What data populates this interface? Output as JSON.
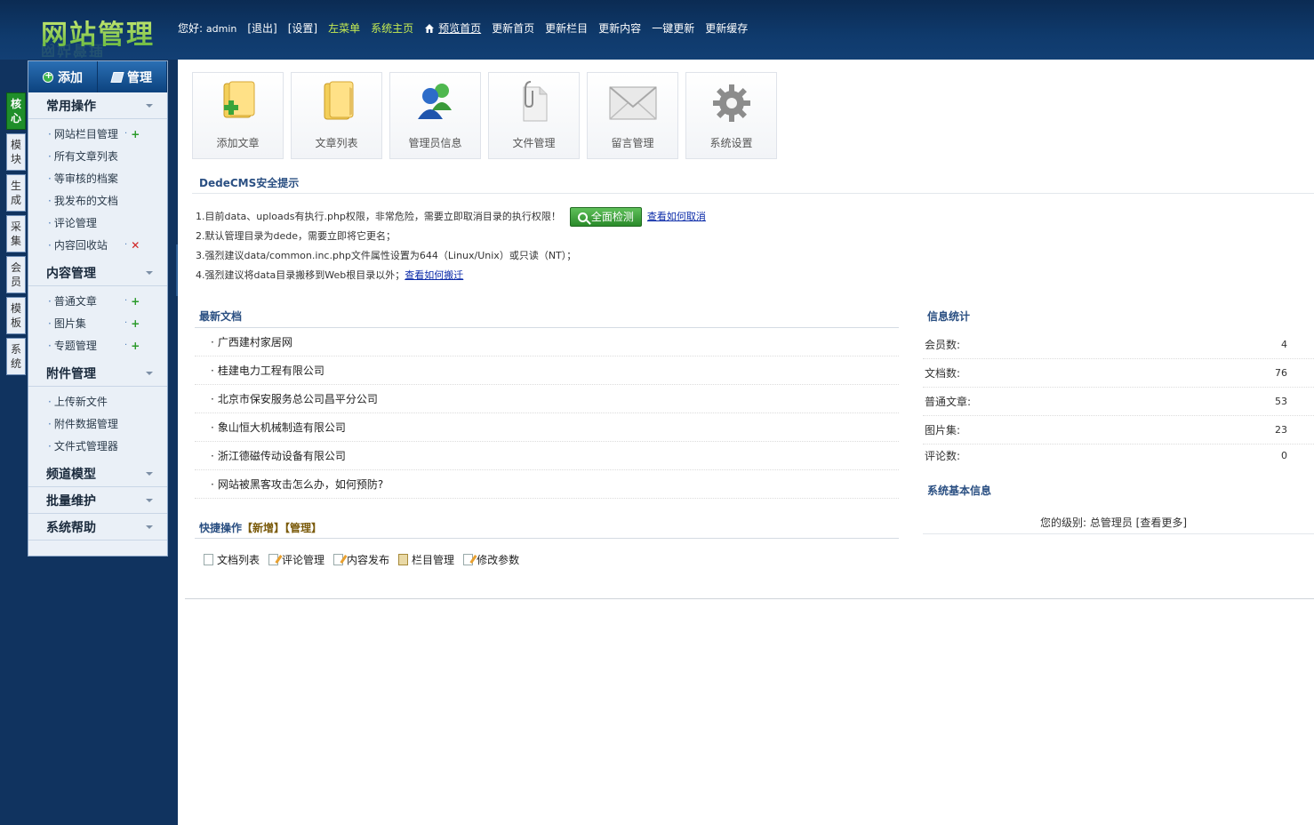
{
  "header": {
    "logo": "网站管理",
    "greeting": "您好:",
    "user": "admin",
    "logout": "[退出]",
    "settings": "[设置]",
    "left_menu": "左菜单",
    "system_home": "系统主页",
    "preview_home": "预览首页",
    "update_home": "更新首页",
    "update_columns": "更新栏目",
    "update_content": "更新内容",
    "one_click_update": "一键更新",
    "update_cache": "更新缓存"
  },
  "vertical_tabs": [
    "核心",
    "模块",
    "生成",
    "采集",
    "会员",
    "模板",
    "系统"
  ],
  "sidebar": {
    "add_label": "添加",
    "manage_label": "管理",
    "groups": [
      {
        "title": "常用操作",
        "items": [
          {
            "label": "网站栏目管理",
            "action": "add"
          },
          {
            "label": "所有文章列表",
            "action": ""
          },
          {
            "label": "等审核的档案",
            "action": ""
          },
          {
            "label": "我发布的文档",
            "action": ""
          },
          {
            "label": "评论管理",
            "action": ""
          },
          {
            "label": "内容回收站",
            "action": "delete"
          }
        ]
      },
      {
        "title": "内容管理",
        "items": [
          {
            "label": "普通文章",
            "action": "add"
          },
          {
            "label": "图片集",
            "action": "add"
          },
          {
            "label": "专题管理",
            "action": "add"
          }
        ]
      },
      {
        "title": "附件管理",
        "items": [
          {
            "label": "上传新文件",
            "action": ""
          },
          {
            "label": "附件数据管理",
            "action": ""
          },
          {
            "label": "文件式管理器",
            "action": ""
          }
        ]
      },
      {
        "title": "频道模型",
        "items": []
      },
      {
        "title": "批量维护",
        "items": []
      },
      {
        "title": "系统帮助",
        "items": []
      }
    ]
  },
  "shortcuts": [
    {
      "label": "添加文章",
      "icon": "add-article-icon"
    },
    {
      "label": "文章列表",
      "icon": "article-list-icon"
    },
    {
      "label": "管理员信息",
      "icon": "admin-info-icon"
    },
    {
      "label": "文件管理",
      "icon": "file-manage-icon"
    },
    {
      "label": "留言管理",
      "icon": "message-manage-icon"
    },
    {
      "label": "系统设置",
      "icon": "system-settings-icon"
    }
  ],
  "security": {
    "title": "DedeCMS安全提示",
    "tip1": "1.目前data、uploads有执行.php权限，非常危险，需要立即取消目录的执行权限！",
    "scan_button": "全面检测",
    "tip1_link": "查看如何取消",
    "tip2": "2.默认管理目录为dede，需要立即将它更名；",
    "tip3": "3.强烈建议data/common.inc.php文件属性设置为644（Linux/Unix）或只读（NT）；",
    "tip4": "4.强烈建议将data目录搬移到Web根目录以外；",
    "tip4_link": "查看如何搬迁"
  },
  "latest_docs": {
    "title": "最新文档",
    "items": [
      "广西建村家居网",
      "桂建电力工程有限公司",
      "北京市保安服务总公司昌平分公司",
      "象山恒大机械制造有限公司",
      "浙江德磁传动设备有限公司",
      "网站被黑客攻击怎么办，如何预防?"
    ]
  },
  "stats": {
    "title": "信息统计",
    "rows": [
      {
        "label": "会员数:",
        "value": "4"
      },
      {
        "label": "文档数:",
        "value": "76"
      },
      {
        "label": "普通文章:",
        "value": "53"
      },
      {
        "label": "图片集:",
        "value": "23"
      },
      {
        "label": "评论数:",
        "value": "0"
      }
    ]
  },
  "sysinfo": {
    "title": "系统基本信息",
    "level_text": "您的级别: 总管理员 [查看更多]"
  },
  "quick": {
    "title": "快捷操作",
    "add_link": "【新增】",
    "manage_link": "【管理】",
    "items": [
      "文档列表",
      "评论管理",
      "内容发布",
      "栏目管理",
      "修改参数"
    ]
  }
}
